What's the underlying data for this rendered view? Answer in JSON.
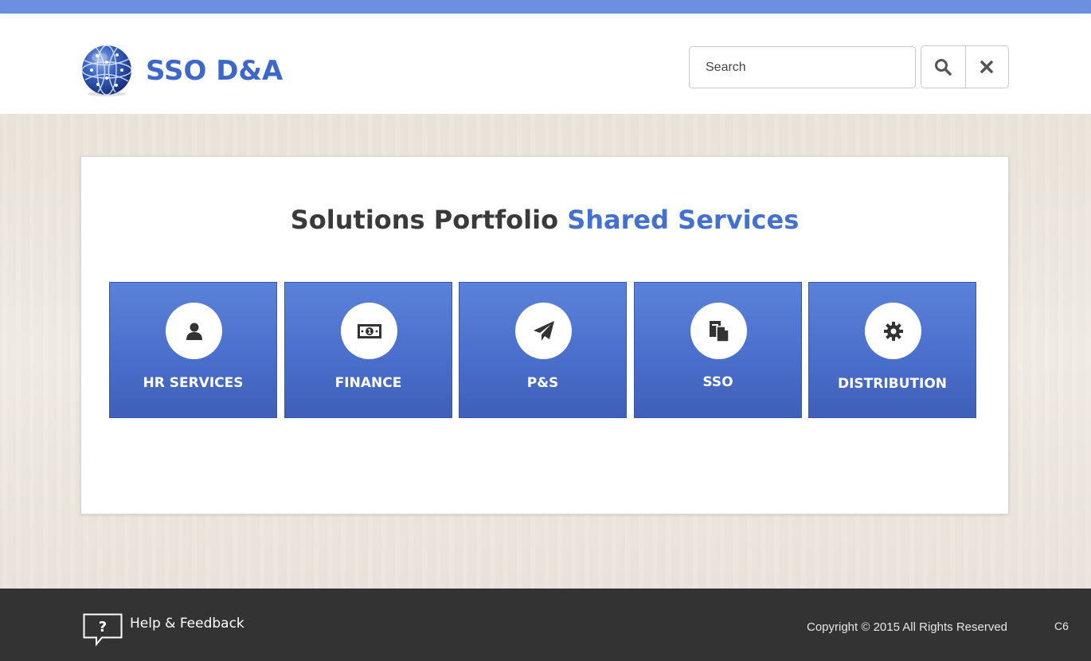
{
  "header": {
    "brand": "SSO D&A",
    "search": {
      "placeholder": "Search",
      "value": ""
    },
    "search_button_icon": "search-icon",
    "clear_button_icon": "close-icon"
  },
  "main": {
    "heading_part1": "Solutions Portfolio",
    "heading_part2": "Shared Services",
    "tiles": [
      {
        "label": "HR SERVICES",
        "icon": "user-icon"
      },
      {
        "label": "FINANCE",
        "icon": "money-icon"
      },
      {
        "label": "P&S",
        "icon": "paper-plane-icon"
      },
      {
        "label": "SSO",
        "icon": "documents-icon"
      },
      {
        "label": "DISTRIBUTION",
        "icon": "gear-icon"
      }
    ]
  },
  "footer": {
    "help_label": "Help & Feedback",
    "copyright": "Copyright © 2015  All Rights Reserved",
    "version": "C6"
  },
  "colors": {
    "brand": "#3d67c8",
    "topbar": "#6c8fdf",
    "tile": "#4a6fcc",
    "footer": "#333333"
  }
}
